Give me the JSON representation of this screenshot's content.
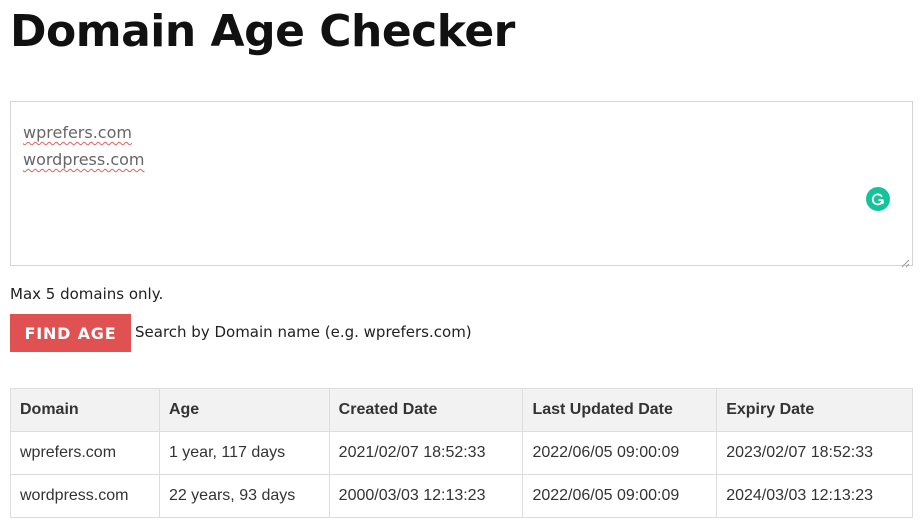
{
  "page": {
    "title": "Domain Age Checker"
  },
  "domains_input": {
    "lines": [
      "wprefers.com",
      "wordpress.com"
    ]
  },
  "form": {
    "helper_text": "Max 5 domains only.",
    "button_label": "FIND AGE",
    "search_hint": "Search by Domain name (e.g. wprefers.com)"
  },
  "results": {
    "headers": [
      "Domain",
      "Age",
      "Created Date",
      "Last Updated Date",
      "Expiry Date"
    ],
    "rows": [
      [
        "wprefers.com",
        "1 year, 117 days",
        "2021/02/07 18:52:33",
        "2022/06/05 09:00:09",
        "2023/02/07 18:52:33"
      ],
      [
        "wordpress.com",
        "22 years, 93 days",
        "2000/03/03 12:13:23",
        "2022/06/05 09:00:09",
        "2024/03/03 12:13:23"
      ]
    ]
  },
  "icons": {
    "grammarly": "grammarly-icon",
    "resize": "resize-handle-icon"
  },
  "colors": {
    "button_bg": "#e05151",
    "grammarly": "#15c39a",
    "header_bg": "#f2f2f2"
  }
}
